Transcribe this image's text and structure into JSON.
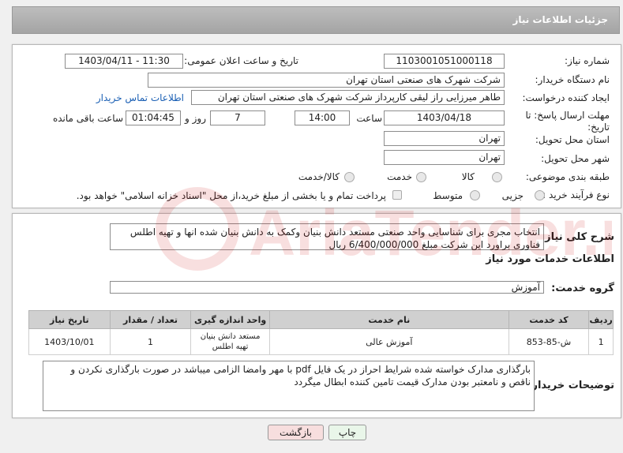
{
  "header": {
    "title": "جزئیات اطلاعات نیاز"
  },
  "form": {
    "need_number_label": "شماره نیاز:",
    "need_number": "1103001051000118",
    "announce_label": "تاریخ و ساعت اعلان عمومی:",
    "announce_value": "1403/04/11 - 11:30",
    "buyer_label": "نام دستگاه خریدار:",
    "buyer_value": "شرکت شهرک های صنعتی استان تهران",
    "creator_label": "ایجاد کننده درخواست:",
    "creator_value": "طاهر  میرزایی راز لیقی کارپرداز شرکت شهرک های صنعتی استان تهران",
    "contact_link": "اطلاعات تماس خریدار",
    "deadline_label": "مهلت ارسال پاسخ: تا تاریخ:",
    "deadline_date": "1403/04/18",
    "time_label": "ساعت",
    "deadline_time": "14:00",
    "days_value": "7",
    "days_label": "روز و",
    "remaining_time": "01:04:45",
    "remaining_label": "ساعت باقی مانده",
    "province_label": "استان محل تحویل:",
    "province_value": "تهران",
    "city_label": "شهر محل تحویل:",
    "city_value": "تهران",
    "category_label": "طبقه بندی موضوعی:",
    "category_options": [
      "کالا",
      "خدمت",
      "کالا/خدمت"
    ],
    "process_label": "نوع فرآیند خرید :",
    "process_options": [
      "جزیی",
      "متوسط"
    ],
    "payment_note": "پرداخت تمام و یا بخشی از مبلغ خرید،از محل \"اسناد خزانه اسلامی\" خواهد بود."
  },
  "summary": {
    "label": "شرح کلی نیاز:",
    "text": "انتخاب مجری برای شناسایی واحد صنعتی مستعد دانش بنیان وکمک به دانش بنیان شده انها و تهیه اطلس فناوری براورد این شرکت مبلغ 6/400/000/000 ریال"
  },
  "services": {
    "section_title": "اطلاعات خدمات مورد نیاز",
    "group_label": "گروه خدمت:",
    "group_value": "آموزش",
    "columns": [
      "ردیف",
      "کد خدمت",
      "نام خدمت",
      "واحد اندازه گیری",
      "تعداد / مقدار",
      "تاریخ نیاز"
    ],
    "rows": [
      {
        "row": "1",
        "code": "ش-85-853",
        "name": "آموزش عالی",
        "unit": "مستعد دانش بنیان تهیه اطلس",
        "qty": "1",
        "date": "1403/10/01"
      }
    ]
  },
  "buyer_notes": {
    "label": "توضیحات خریدار:",
    "text": "بارگذاری مدارک خواسته شده  شرایط احراز در یک فایل pdf  با مهر وامضا الزامی میباشد در صورت بارگذاری نکردن و ناقص و نامعتبر بودن مدارک قیمت تامین کننده ابطال میگردد"
  },
  "buttons": {
    "print": "چاپ",
    "back": "بازگشت"
  },
  "watermark": {
    "text": "AriaTender.neT"
  },
  "colors": {
    "link": "#1a5fb4",
    "back_button": "#f7dede",
    "print_button": "#e9f6e9",
    "header": "#a9a9a9"
  }
}
